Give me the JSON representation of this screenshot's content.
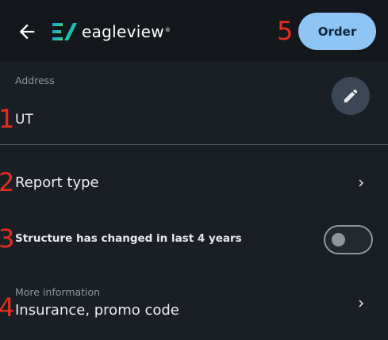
{
  "header": {
    "back_icon": "arrow-left-icon",
    "logo_text": "eagleview",
    "logo_trademark": "®",
    "order_label": "Order"
  },
  "address": {
    "label": "Address",
    "value": "UT",
    "edit_icon": "pencil-icon"
  },
  "report_type": {
    "label": "Report type",
    "icon": "chevron-right-icon"
  },
  "structure_changed": {
    "label": "Structure has changed in last 4 years",
    "enabled": false
  },
  "more_information": {
    "label": "More information",
    "value": "Insurance, promo code",
    "icon": "chevron-right-icon"
  },
  "annotations": {
    "address": "1",
    "report_type": "2",
    "structure": "3",
    "more_info": "4",
    "order": "5"
  },
  "colors": {
    "background": "#1a1f26",
    "topbar": "#14181d",
    "order_button": "#8ec5f5",
    "edit_button": "#3b4757",
    "annotation_marker": "#e52d1d",
    "secondary_text": "#8e959c"
  }
}
